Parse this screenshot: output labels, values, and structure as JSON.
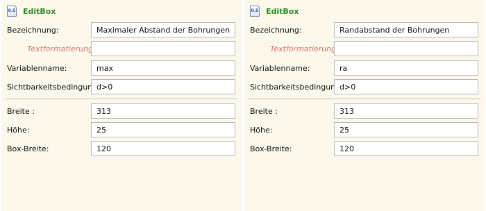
{
  "panels": [
    {
      "title": "EditBox",
      "icon": "editbox-doc-icon",
      "icon_text": "0.5",
      "fields": [
        {
          "label": "Bezeichnung:",
          "value": "Maximaler Abstand der Bohrungen"
        },
        {
          "label": "Textformatierung:",
          "value": ""
        },
        {
          "label": "Variablenname:",
          "value": "max"
        },
        {
          "label": "Sichtbarkeitsbedingung:",
          "value": "d>0"
        },
        {
          "label": "Breite :",
          "value": "313"
        },
        {
          "label": "Höhe:",
          "value": "25"
        },
        {
          "label": "Box-Breite:",
          "value": "120"
        }
      ]
    },
    {
      "title": "EditBox",
      "icon": "editbox-doc-icon",
      "icon_text": "0.5",
      "fields": [
        {
          "label": "Bezeichnung:",
          "value": "Randabstand der Bohrungen"
        },
        {
          "label": "Textformatierung:",
          "value": ""
        },
        {
          "label": "Variablenname:",
          "value": "ra"
        },
        {
          "label": "Sichtbarkeitsbedingung:",
          "value": "d>0"
        },
        {
          "label": "Breite :",
          "value": "313"
        },
        {
          "label": "Höhe:",
          "value": "25"
        },
        {
          "label": "Box-Breite:",
          "value": "120"
        }
      ]
    }
  ],
  "colors": {
    "panel_bg": "#fdf8ec",
    "title": "#2e8b23",
    "hint_label": "#e0706a"
  }
}
